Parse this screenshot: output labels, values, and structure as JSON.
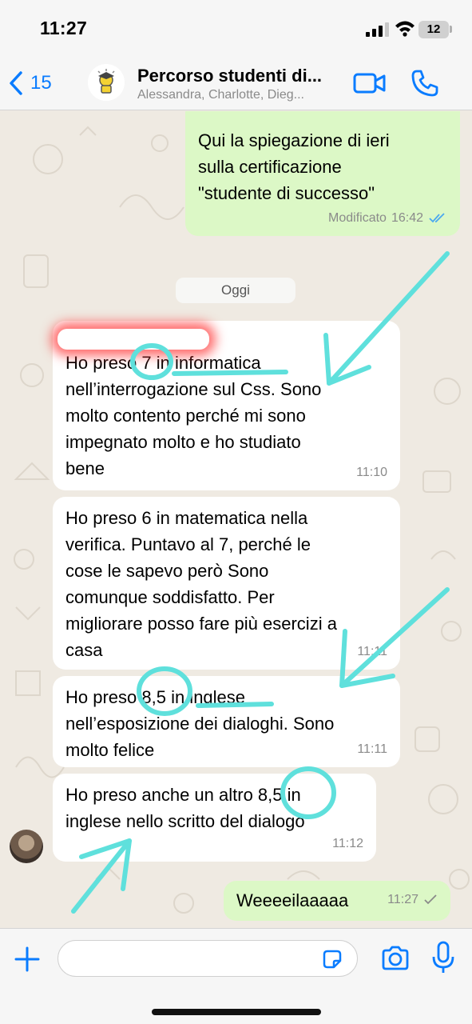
{
  "status_bar": {
    "time": "11:27",
    "battery": "12"
  },
  "header": {
    "back_count": "15",
    "title": "Percorso studenti di...",
    "subtitle": "Alessandra, Charlotte, Dieg..."
  },
  "date_divider": "Oggi",
  "messages": [
    {
      "direction": "out",
      "text": "Qui la spiegazione di ieri\nsulla certificazione\n\"studente di successo\"",
      "meta": "Modificato",
      "time": "16:42",
      "status": "read"
    },
    {
      "direction": "in",
      "text": "Ho preso 7 in informatica\nnell’interrogazione sul Css. Sono\nmolto contento perché mi sono\nimpegnato molto e ho studiato\nbene",
      "time": "11:10"
    },
    {
      "direction": "in",
      "text": "Ho preso 6 in matematica nella\nverifica. Puntavo al 7, perché le\ncose le sapevo però Sono\ncomunque soddisfatto. Per\nmigliorare posso fare più esercizi a\ncasa",
      "time": "11:11"
    },
    {
      "direction": "in",
      "text": "Ho preso 8,5 in inglese\nnell’esposizione dei dialoghi. Sono\nmolto felice",
      "time": "11:11"
    },
    {
      "direction": "in",
      "text": "Ho preso anche un altro 8,5 in\ninglese nello scritto del dialogo",
      "time": "11:12"
    },
    {
      "direction": "out",
      "text": "Weeeeilaaaaa",
      "time": "11:27",
      "status": "sent"
    }
  ],
  "input": {
    "placeholder": "",
    "value": ""
  },
  "colors": {
    "accent": "#0a7cff",
    "outgoing_bubble": "#dcf8c6",
    "incoming_bubble": "#ffffff",
    "annotation": "#5fe0dc",
    "chat_background": "#efeae2"
  },
  "icons": [
    "back-chevron-icon",
    "group-avatar",
    "video-camera-icon",
    "phone-icon",
    "read-receipt-icon",
    "sent-check-icon",
    "plus-icon",
    "sticker-icon",
    "camera-icon",
    "microphone-icon"
  ]
}
